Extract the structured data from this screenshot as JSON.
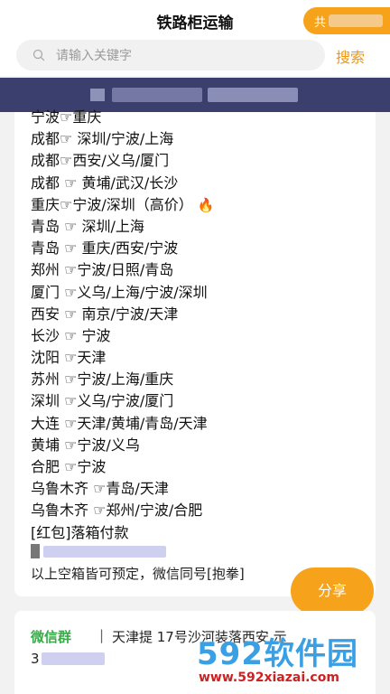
{
  "header": {
    "title": "铁路柜运输",
    "share_pill_text": "共"
  },
  "search": {
    "placeholder": "请输入关键字",
    "button_label": "搜索"
  },
  "routes": [
    "宁波☞重庆",
    "成都☞ 深圳/宁波/上海",
    "成都☞西安/义乌/厦门",
    "成都 ☞ 黄埔/武汉/长沙",
    "重庆☞宁波/深圳（高价）",
    "青岛 ☞ 深圳/上海",
    "青岛 ☞ 重庆/西安/宁波",
    "郑州 ☞宁波/日照/青岛",
    "厦门 ☞义乌/上海/宁波/深圳",
    "西安 ☞ 南京/宁波/天津",
    "长沙 ☞ 宁波",
    "沈阳 ☞天津",
    "苏州 ☞宁波/上海/重庆",
    "深圳 ☞义乌/宁波/厦门",
    "大连 ☞天津/黄埔/青岛/天津",
    "黄埔 ☞宁波/义乌",
    "合肥 ☞宁波",
    "乌鲁木齐 ☞青岛/天津",
    "乌鲁木齐 ☞郑州/宁波/合肥",
    "[红包]落箱付款"
  ],
  "note": "以上空箱皆可预定，微信同号[抱拳]",
  "float_share_label": "分享",
  "group": {
    "label": "微信群",
    "separator": "|",
    "text": "天津提 17号沙河装落西安 示",
    "number_prefix": "3"
  },
  "watermark": {
    "brand": "592软件园",
    "url": "www.592xiazai.com"
  },
  "colors": {
    "accent_orange": "#f7a21b",
    "search_orange": "#f0960f",
    "banner_navy": "#3b3f6e",
    "wechat_green": "#3aa94a"
  }
}
